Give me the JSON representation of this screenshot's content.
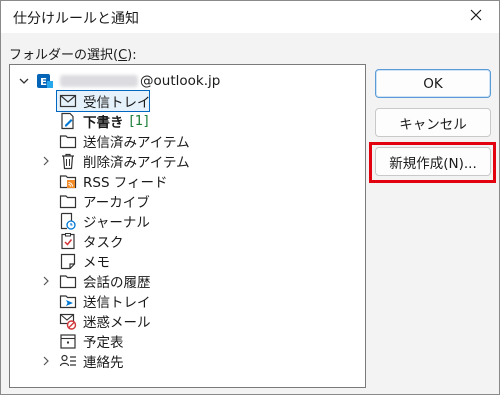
{
  "window": {
    "title": "仕分けルールと通知",
    "close_icon": "close-icon"
  },
  "folder_label": {
    "prefix": "フォルダーの選択(",
    "mnemonic": "C",
    "suffix": "):"
  },
  "tree": {
    "account": {
      "name": "@outlook.jp",
      "icon": "exchange-account-icon",
      "expanded": true
    },
    "items": [
      {
        "label": "受信トレイ",
        "icon": "inbox-icon",
        "selected": true
      },
      {
        "label": "下書き",
        "icon": "drafts-icon",
        "bold": true,
        "count": "[1]"
      },
      {
        "label": "送信済みアイテム",
        "icon": "sent-items-icon"
      },
      {
        "label": "削除済みアイテム",
        "icon": "deleted-items-icon",
        "expandable": true
      },
      {
        "label": "RSS フィード",
        "icon": "rss-folder-icon"
      },
      {
        "label": "アーカイブ",
        "icon": "archive-folder-icon"
      },
      {
        "label": "ジャーナル",
        "icon": "journal-icon"
      },
      {
        "label": "タスク",
        "icon": "tasks-icon"
      },
      {
        "label": "メモ",
        "icon": "notes-icon"
      },
      {
        "label": "会話の履歴",
        "icon": "conversation-history-icon",
        "expandable": true
      },
      {
        "label": "送信トレイ",
        "icon": "outbox-icon"
      },
      {
        "label": "迷惑メール",
        "icon": "junk-email-icon"
      },
      {
        "label": "予定表",
        "icon": "calendar-icon"
      },
      {
        "label": "連絡先",
        "icon": "contacts-icon",
        "expandable": true
      }
    ]
  },
  "buttons": {
    "ok": "OK",
    "cancel": "キャンセル",
    "new_folder": "新規作成(N)..."
  },
  "colors": {
    "highlight": "#e3000f",
    "selection": "#0067c0",
    "count": "#1d7f3a",
    "exchange": "#0364b8"
  }
}
